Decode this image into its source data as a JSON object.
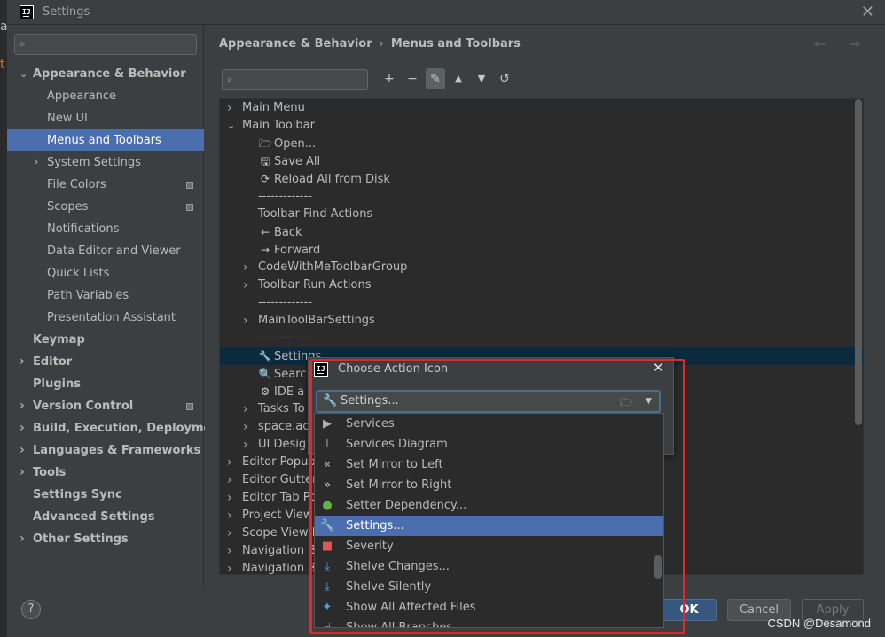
{
  "window": {
    "title": "Settings"
  },
  "sidebar": {
    "items": [
      {
        "label": "Appearance & Behavior",
        "bold": true,
        "expanded": true
      },
      {
        "label": "Appearance"
      },
      {
        "label": "New UI"
      },
      {
        "label": "Menus and Toolbars",
        "selected": true
      },
      {
        "label": "System Settings",
        "collapsible": true
      },
      {
        "label": "File Colors",
        "badge": true
      },
      {
        "label": "Scopes",
        "badge": true
      },
      {
        "label": "Notifications"
      },
      {
        "label": "Data Editor and Viewer"
      },
      {
        "label": "Quick Lists"
      },
      {
        "label": "Path Variables"
      },
      {
        "label": "Presentation Assistant"
      },
      {
        "label": "Keymap",
        "bold": true
      },
      {
        "label": "Editor",
        "bold": true,
        "collapsible": true
      },
      {
        "label": "Plugins",
        "bold": true
      },
      {
        "label": "Version Control",
        "bold": true,
        "collapsible": true,
        "badge": true
      },
      {
        "label": "Build, Execution, Deployment",
        "bold": true,
        "collapsible": true
      },
      {
        "label": "Languages & Frameworks",
        "bold": true,
        "collapsible": true
      },
      {
        "label": "Tools",
        "bold": true,
        "collapsible": true
      },
      {
        "label": "Settings Sync",
        "bold": true
      },
      {
        "label": "Advanced Settings",
        "bold": true
      },
      {
        "label": "Other Settings",
        "bold": true,
        "collapsible": true
      }
    ]
  },
  "breadcrumb": {
    "parent": "Appearance & Behavior",
    "separator": "›",
    "current": "Menus and Toolbars"
  },
  "nav_arrows": "← →",
  "toolbar": {
    "add": "+",
    "remove": "−",
    "edit": "✎",
    "up": "▲",
    "down": "▼",
    "restore": "↺"
  },
  "actions": [
    {
      "label": "Main Menu",
      "arrow": "›"
    },
    {
      "label": "Main Toolbar",
      "arrow": "⌄"
    },
    {
      "label": "Open...",
      "icon": "🗁"
    },
    {
      "label": "Save All",
      "icon": "🖫"
    },
    {
      "label": "Reload All from Disk",
      "icon": "⟳"
    },
    {
      "label": "-------------"
    },
    {
      "label": "Toolbar Find Actions"
    },
    {
      "label": "Back",
      "icon": "←"
    },
    {
      "label": "Forward",
      "icon": "→"
    },
    {
      "label": "CodeWithMeToolbarGroup",
      "arrow": "›"
    },
    {
      "label": "Toolbar Run Actions",
      "arrow": "›"
    },
    {
      "label": "-------------"
    },
    {
      "label": "MainToolBarSettings",
      "arrow": "›"
    },
    {
      "label": "-------------"
    },
    {
      "label": "Settings",
      "icon": "🔧",
      "selected": true
    },
    {
      "label": "Searc",
      "icon": "🔍"
    },
    {
      "label": "IDE a",
      "icon": "⚙"
    },
    {
      "label": "Tasks To",
      "arrow": "›"
    },
    {
      "label": "space.ac",
      "arrow": "›"
    },
    {
      "label": "UI Desig",
      "arrow": "›"
    },
    {
      "label": "Editor Popup",
      "arrow": "›"
    },
    {
      "label": "Editor Gutter",
      "arrow": "›"
    },
    {
      "label": "Editor Tab Po",
      "arrow": "›"
    },
    {
      "label": "Project View",
      "arrow": "›"
    },
    {
      "label": "Scope View Po",
      "arrow": "›"
    },
    {
      "label": "Navigation Ba",
      "arrow": "›"
    },
    {
      "label": "Navigation Ba",
      "arrow": "›"
    }
  ],
  "popup": {
    "title": "Choose Action Icon",
    "combo_icon": "🔧",
    "combo_value": "Settings...",
    "folder_icon": "🗁",
    "dropdown_arrow": "▼",
    "options": [
      {
        "label": "Services",
        "icon": "▶",
        "color": "#aab0b6"
      },
      {
        "label": "Services Diagram",
        "icon": "⊥",
        "color": "#c8c8c8"
      },
      {
        "label": "Set Mirror to Left",
        "icon": "«",
        "color": "#c8c8c8"
      },
      {
        "label": "Set Mirror to Right",
        "icon": "»",
        "color": "#c8c8c8"
      },
      {
        "label": "Setter Dependency...",
        "icon": "●",
        "color": "#62b543"
      },
      {
        "label": "Settings...",
        "icon": "🔧",
        "color": "#ffffff",
        "selected": true
      },
      {
        "label": "Severity",
        "icon": "■",
        "color": "#e05555"
      },
      {
        "label": "Shelve Changes...",
        "icon": "⤓",
        "color": "#4aa3df"
      },
      {
        "label": "Shelve Silently",
        "icon": "⤓",
        "color": "#4aa3df"
      },
      {
        "label": "Show All Affected Files",
        "icon": "✦",
        "color": "#4aa3df"
      },
      {
        "label": "Show All Branches",
        "icon": "⑂",
        "color": "#c8c8c8"
      }
    ]
  },
  "footer": {
    "help": "?",
    "ok": "OK",
    "cancel": "Cancel",
    "apply": "Apply"
  },
  "highlight_color": "#e3272a",
  "watermark": "CSDN @Desamond",
  "bg_letters": [
    "a",
    "t"
  ]
}
